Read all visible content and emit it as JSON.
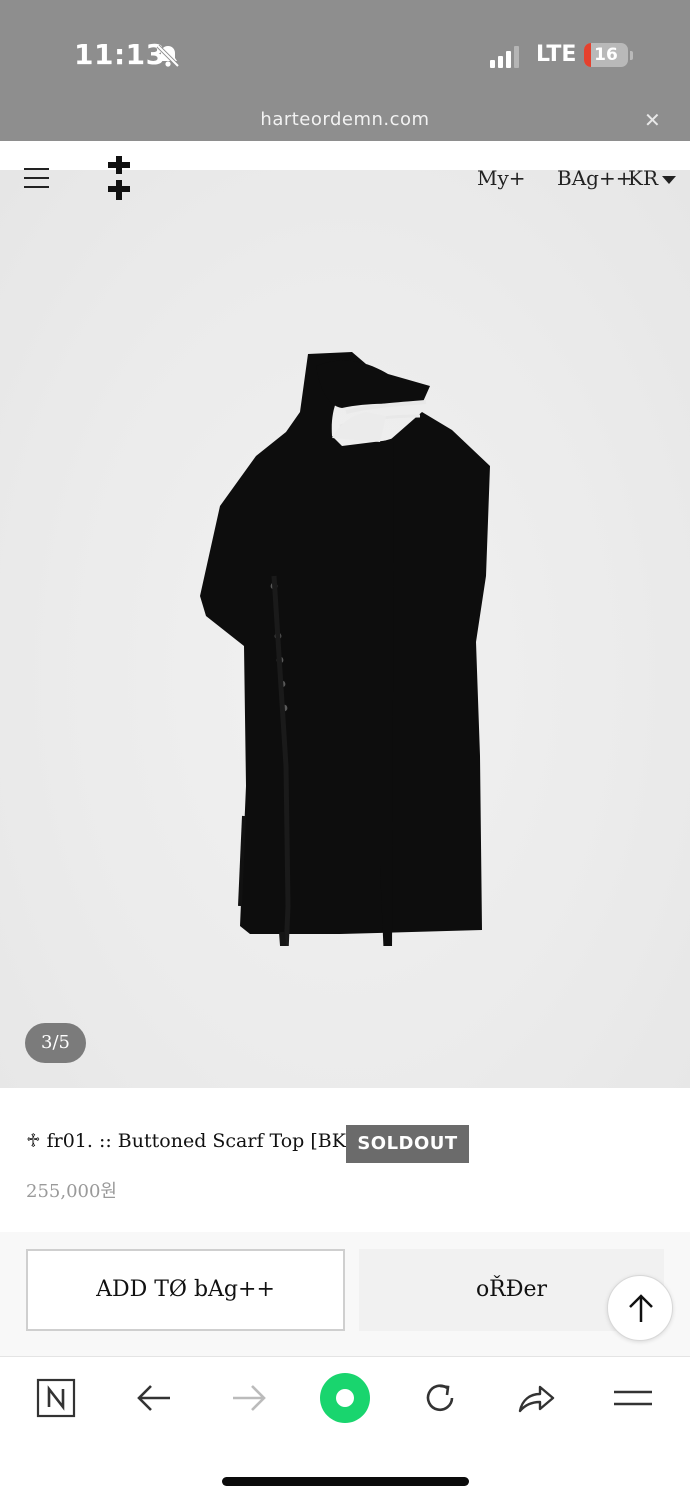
{
  "status_bar": {
    "time": "11:13",
    "network": "LTE",
    "battery_level": "16",
    "battery_fraction": 0.16,
    "icons": [
      "bell-slash-icon",
      "signal-icon",
      "battery-icon"
    ]
  },
  "browser": {
    "url": "harteordemn.com",
    "close_icon": "✕"
  },
  "header": {
    "menu_icon": "hamburger-icon",
    "logo_icon": "double-cross-logo",
    "my_label": "My+",
    "bag_label": "BAg++",
    "lang_label": "KR"
  },
  "gallery": {
    "counter": "3/5"
  },
  "product": {
    "title": "♱ fr01. :: Buttoned Scarf Top [BK]",
    "badge": "SOLDOUT",
    "price": "255,000원"
  },
  "actions": {
    "add_to_bag": "ADD TØ bAg++",
    "order": "oŘĐer"
  },
  "toolbar": {
    "icons": [
      "naver-n-icon",
      "back-arrow-icon",
      "forward-arrow-icon",
      "green-record-icon",
      "reload-icon",
      "share-icon",
      "menu-lines-icon"
    ]
  },
  "colors": {
    "status_bar_bg": "#8e8e8e",
    "soldout_bg": "#6b6b6b",
    "accent_green": "#19d56e",
    "battery_red": "#e5412e"
  }
}
